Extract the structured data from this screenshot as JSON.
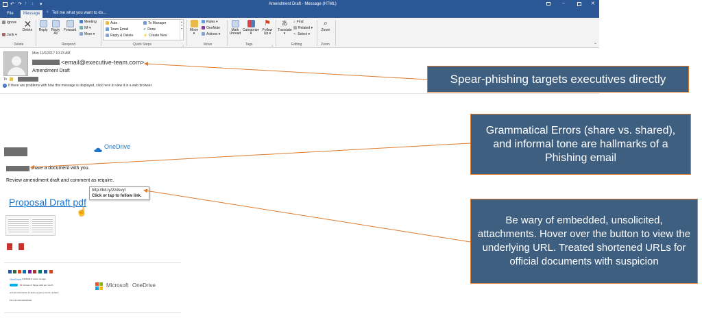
{
  "window": {
    "title": "Amendment Draft - Message (HTML)",
    "tabs": [
      "File",
      "Message"
    ],
    "tell_me": "Tell me what you want to do..."
  },
  "ribbon": {
    "delete_group": {
      "label": "Delete",
      "ignore": "Ignore",
      "junk": "Junk",
      "delete": "Delete"
    },
    "respond_group": {
      "label": "Respond",
      "reply": "Reply",
      "reply_all_1": "Reply",
      "reply_all_2": "All",
      "forward": "Forward",
      "meeting": "Meeting",
      "im": "IM",
      "more": "More"
    },
    "quick_steps": {
      "label": "Quick Steps",
      "items": [
        "Auto",
        "Team Email",
        "Reply & Delete",
        "To Manager",
        "Done",
        "Create New"
      ]
    },
    "move_group": {
      "label": "Move",
      "move": "Move",
      "rules": "Rules",
      "onenote": "OneNote",
      "actions": "Actions"
    },
    "tags_group": {
      "label": "Tags",
      "mark_unread_1": "Mark",
      "mark_unread_2": "Unread",
      "categorize": "Categorize",
      "follow_up_1": "Follow",
      "follow_up_2": "Up"
    },
    "editing_group": {
      "label": "Editing",
      "translate": "Translate",
      "find": "Find",
      "related": "Related",
      "select": "Select"
    },
    "zoom_group": {
      "label": "Zoom",
      "zoom": "Zoom"
    }
  },
  "message": {
    "date": "Mon 11/6/2017 10:23 AM",
    "sender_email": "<email@executive-team.com>",
    "subject": "Amendment Draft",
    "to_label": "To",
    "info_bar": "If there are problems with how this message is displayed, click here to view it in a web browser."
  },
  "body": {
    "onedrive_logo": "OneDrive",
    "shared_line": "share a document with you.",
    "instruction": "Review amendment draft and comment as require.",
    "link_text": "Proposal Draft pdf",
    "tooltip_url": "http://bit.ly/2zdsvyl",
    "tooltip_hint": "Click or tap to follow link.",
    "footer_onedrive": "OneDrive",
    "footer_storage": "1,000GB of online storage",
    "footer_skype": "60 minutes of Skype calls per month",
    "footer_subscription": "Annual subscription includes ongoing version updates",
    "footer_noncommercial": "For non-commercial use",
    "ms_brand_1": "Microsoft",
    "ms_brand_2": "OneDrive"
  },
  "callouts": {
    "spear": "Spear-phishing targets executives directly",
    "grammar": "Grammatical Errors (share vs. shared), and informal tone are hallmarks of a Phishing email",
    "attachments": "Be wary of embedded, unsolicited, attachments. Hover over the button to view the underlying URL. Treated shortened URLs for official documents with suspicion"
  },
  "colors": {
    "titlebar": "#2b5797",
    "callout_bg": "#3e5f80",
    "callout_border": "#e07b2c",
    "arrow": "#e07b2c",
    "link": "#1e73c8"
  }
}
